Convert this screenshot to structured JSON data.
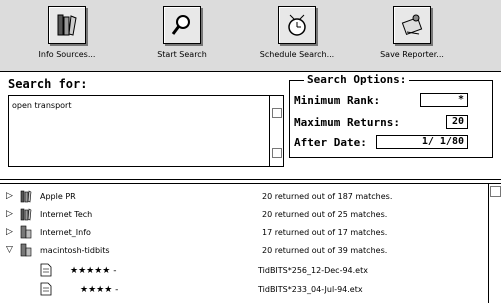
{
  "toolbar": {
    "buttons": [
      {
        "label": "Info Sources...",
        "icon": "books-icon"
      },
      {
        "label": "Start Search",
        "icon": "magnifier-icon"
      },
      {
        "label": "Schedule Search...",
        "icon": "alarm-clock-icon"
      },
      {
        "label": "Save Reporter...",
        "icon": "save-reporter-icon"
      }
    ]
  },
  "search": {
    "title": "Search for:",
    "query": "open transport"
  },
  "options": {
    "title": "Search Options:",
    "min_rank_label": "Minimum Rank:",
    "min_rank_value": "*",
    "max_returns_label": "Maximum Returns:",
    "max_returns_value": "20",
    "after_date_label": "After Date:",
    "after_date_value": "1/ 1/80"
  },
  "results": {
    "sources": [
      {
        "name": "Apple PR",
        "count": "20 returned out of 187 matches.",
        "expanded": false
      },
      {
        "name": "Internet Tech",
        "count": "20 returned out of 25 matches.",
        "expanded": false
      },
      {
        "name": "Internet_Info",
        "count": "17 returned out of 17 matches.",
        "expanded": false
      },
      {
        "name": "macintosh-tidbits",
        "count": "20 returned out of 39 matches.",
        "expanded": true
      }
    ],
    "documents": [
      {
        "stars": "★★★★★ -",
        "file": "TidBITS*256_12-Dec-94.etx"
      },
      {
        "stars": "★★★★ -",
        "file": "TidBITS*233_04-Jul-94.etx"
      }
    ]
  }
}
